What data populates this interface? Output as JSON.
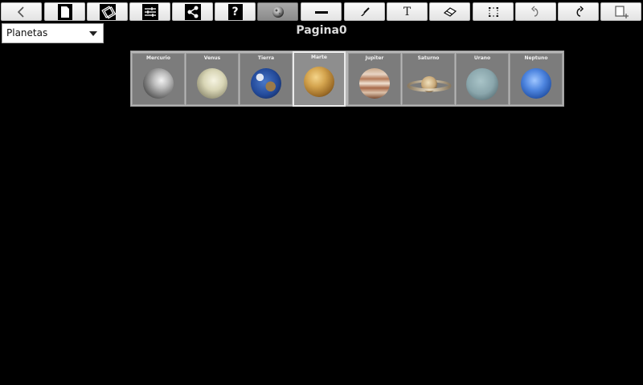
{
  "toolbar": {
    "buttons": [
      {
        "name": "back",
        "icon": "back-icon"
      },
      {
        "name": "new-page",
        "icon": "document-icon"
      },
      {
        "name": "pages",
        "icon": "pages-icon"
      },
      {
        "name": "settings",
        "icon": "sliders-icon"
      },
      {
        "name": "share",
        "icon": "share-icon"
      },
      {
        "name": "help",
        "icon": "help-icon",
        "label": "?"
      },
      {
        "name": "stamps",
        "icon": "planet-stamp-icon",
        "active": true
      },
      {
        "name": "line",
        "icon": "line-icon"
      },
      {
        "name": "brush",
        "icon": "brush-icon"
      },
      {
        "name": "text",
        "icon": "text-icon",
        "label": "T"
      },
      {
        "name": "eraser",
        "icon": "eraser-icon"
      },
      {
        "name": "select",
        "icon": "selection-icon"
      },
      {
        "name": "undo",
        "icon": "undo-icon"
      },
      {
        "name": "redo",
        "icon": "redo-icon"
      },
      {
        "name": "add-page",
        "icon": "add-page-icon"
      }
    ]
  },
  "category_select": {
    "value": "Planetas"
  },
  "page": {
    "title": "Pagina0"
  },
  "planets": [
    {
      "name": "Mercurio",
      "selected": false
    },
    {
      "name": "Venus",
      "selected": false
    },
    {
      "name": "Tierra",
      "selected": false
    },
    {
      "name": "Marte",
      "selected": true
    },
    {
      "name": "Jupiter",
      "selected": false
    },
    {
      "name": "Saturno",
      "selected": false
    },
    {
      "name": "Urano",
      "selected": false
    },
    {
      "name": "Neptuno",
      "selected": false
    }
  ],
  "colors": {
    "background": "#000000",
    "title": "#dcdcdc",
    "strip": "#b6b6b6",
    "card": "#7c7c7c",
    "selected_border": "#eaeaea"
  }
}
